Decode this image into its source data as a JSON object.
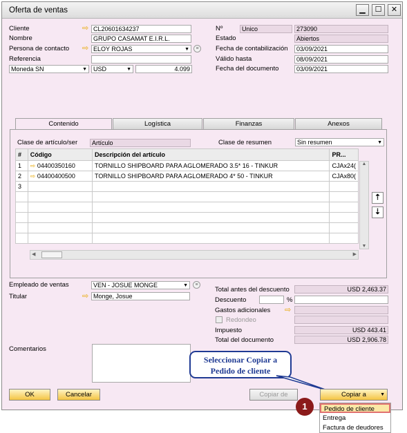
{
  "window": {
    "title": "Oferta de ventas"
  },
  "header_left": {
    "cliente_label": "Cliente",
    "cliente_value": "CL20601634237",
    "nombre_label": "Nombre",
    "nombre_value": "GRUPO CASAMAT E.I.R.L.",
    "contacto_label": "Persona de contacto",
    "contacto_value": "ELOY ROJAS",
    "referencia_label": "Referencia",
    "referencia_value": "",
    "moneda_label": "Moneda SN",
    "moneda_value": "USD",
    "tipo_cambio": "4.099"
  },
  "header_right": {
    "no_label": "Nº",
    "serie_value": "Unico",
    "no_value": "273090",
    "estado_label": "Estado",
    "estado_value": "Abiertos",
    "fecha_cont_label": "Fecha de contabilización",
    "fecha_cont_value": "03/09/2021",
    "valido_label": "Válido hasta",
    "valido_value": "08/09/2021",
    "fecha_doc_label": "Fecha del documento",
    "fecha_doc_value": "03/09/2021"
  },
  "tabs": [
    "Contenido",
    "Logística",
    "Finanzas",
    "Anexos"
  ],
  "content": {
    "clase_articulo_label": "Clase de artículo/ser",
    "clase_articulo_value": "Artículo",
    "clase_resumen_label": "Clase de resumen",
    "clase_resumen_value": "Sin resumen",
    "columns": [
      "#",
      "Código",
      "Descripción del artículo",
      "PR..."
    ],
    "rows": [
      {
        "n": "1",
        "codigo": "04400350160",
        "desc": "TORNILLO SHIPBOARD PARA AGLOMERADO 3.5* 16 - TINKUR",
        "pr": "CJAx24("
      },
      {
        "n": "2",
        "codigo": "04400400500",
        "desc": "TORNILLO SHIPBOARD PARA AGLOMERADO 4* 50 - TINKUR",
        "pr": "CJAx80("
      },
      {
        "n": "3",
        "codigo": "",
        "desc": "",
        "pr": ""
      },
      {
        "n": "",
        "codigo": "",
        "desc": "",
        "pr": ""
      },
      {
        "n": "",
        "codigo": "",
        "desc": "",
        "pr": ""
      },
      {
        "n": "",
        "codigo": "",
        "desc": "",
        "pr": ""
      },
      {
        "n": "",
        "codigo": "",
        "desc": "",
        "pr": ""
      },
      {
        "n": "",
        "codigo": "",
        "desc": "",
        "pr": ""
      }
    ]
  },
  "footer_left": {
    "empleado_label": "Empleado de ventas",
    "empleado_value": "VEN - JOSUE MONGE",
    "titular_label": "Titular",
    "titular_value": "Monge, Josue",
    "comentarios_label": "Comentarios"
  },
  "totals": {
    "total_antes_label": "Total antes del descuento",
    "total_antes_value": "USD 2,463.37",
    "descuento_label": "Descuento",
    "descuento_pct": "%",
    "gastos_label": "Gastos adicionales",
    "redondeo_label": "Redondeo",
    "impuesto_label": "Impuesto",
    "impuesto_value": "USD 443.41",
    "total_doc_label": "Total del documento",
    "total_doc_value": "USD 2,906.78"
  },
  "callout": {
    "line1": "Seleccionar Copiar a",
    "line2": "Pedido de cliente",
    "step": "1"
  },
  "buttons": {
    "ok": "OK",
    "cancel": "Cancelar",
    "copy_from": "Copiar de",
    "copy_to": "Copiar a"
  },
  "copy_menu": [
    "Pedido de cliente",
    "Entrega",
    "Factura de deudores"
  ],
  "colors": {
    "accent_yellow": "#f4c443",
    "callout_border": "#1f3a93",
    "step_badge": "#8b1a1a",
    "highlight": "#e07070"
  }
}
